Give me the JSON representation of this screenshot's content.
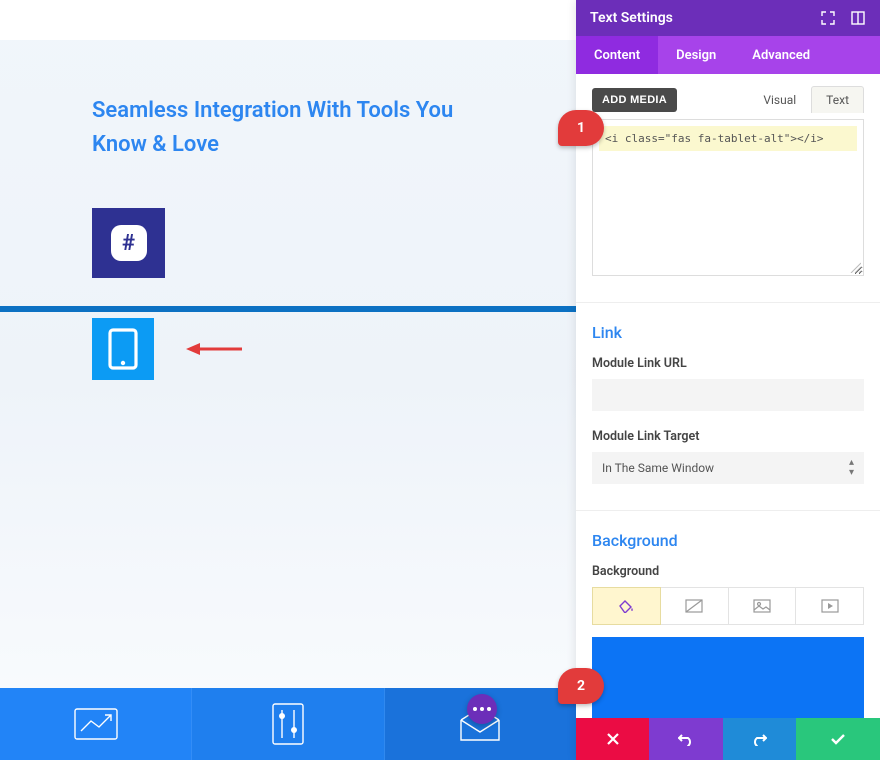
{
  "preview": {
    "heading": "Seamless Integration With Tools You Know & Love"
  },
  "sidebar": {
    "title": "Text Settings",
    "tabs": {
      "content": "Content",
      "design": "Design",
      "advanced": "Advanced"
    },
    "add_media": "ADD MEDIA",
    "editor_tabs": {
      "visual": "Visual",
      "text": "Text"
    },
    "code": "<i class=\"fas fa-tablet-alt\"></i>",
    "link": {
      "title": "Link",
      "url_label": "Module Link URL",
      "url_value": "",
      "target_label": "Module Link Target",
      "target_value": "In The Same Window"
    },
    "background": {
      "title": "Background",
      "label": "Background",
      "color": "#0c74f5"
    }
  },
  "badges": {
    "one": "1",
    "two": "2"
  },
  "icons": {
    "slack": "slack-icon",
    "tablet": "tablet-icon",
    "expand": "expand-icon",
    "columns": "columns-icon",
    "paint": "paint-bucket-icon",
    "gradient": "gradient-icon",
    "image": "image-icon",
    "video": "video-icon"
  }
}
